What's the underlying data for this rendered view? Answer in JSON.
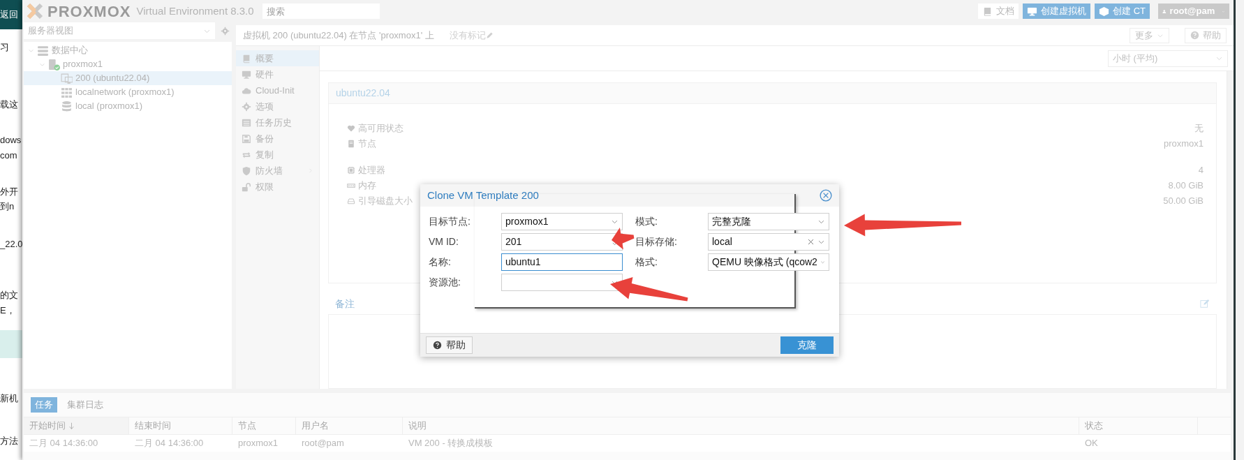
{
  "background_page": {
    "back_button": "返回",
    "fragments": [
      "习",
      "载这",
      "dows",
      "com",
      "外开",
      "到n",
      "_22.0",
      "的文",
      "E，",
      "新机",
      "方法"
    ]
  },
  "header": {
    "logo": "PROXMOX",
    "product": "Virtual Environment 8.3.0",
    "search_placeholder": "搜索",
    "buttons": [
      {
        "label": "文档",
        "kind": "docs"
      },
      {
        "label": "创建虚拟机",
        "kind": "vm"
      },
      {
        "label": "创建 CT",
        "kind": "ct"
      }
    ],
    "user": "root@pam"
  },
  "tree_panel": {
    "view": "服务器视图",
    "tree": [
      {
        "label": "数据中心",
        "kind": "datacenter",
        "expanded": true,
        "selected": false,
        "children": [
          {
            "label": "proxmox1",
            "kind": "node",
            "expanded": true,
            "selected": false,
            "children": [
              {
                "label": "200 (ubuntu22.04)",
                "kind": "template",
                "selected": true
              },
              {
                "label": "localnetwork (proxmox1)",
                "kind": "network",
                "selected": false
              },
              {
                "label": "local (proxmox1)",
                "kind": "storage",
                "selected": false
              }
            ]
          }
        ]
      }
    ]
  },
  "content": {
    "title": "虚拟机 200 (ubuntu22.04) 在节点 'proxmox1' 上",
    "tags": "没有标记",
    "buttons": [
      {
        "label": "更多",
        "kind": "menu"
      },
      {
        "label": "帮助",
        "kind": "help"
      }
    ],
    "menu": [
      {
        "label": "概要",
        "kind": "summary",
        "selected": true,
        "has_submenu": false
      },
      {
        "label": "硬件",
        "kind": "hardware",
        "selected": false,
        "has_submenu": false
      },
      {
        "label": "Cloud-Init",
        "kind": "cloudinit",
        "selected": false,
        "has_submenu": false
      },
      {
        "label": "选项",
        "kind": "options",
        "selected": false,
        "has_submenu": false
      },
      {
        "label": "任务历史",
        "kind": "history",
        "selected": false,
        "has_submenu": false
      },
      {
        "label": "备份",
        "kind": "backup",
        "selected": false,
        "has_submenu": false
      },
      {
        "label": "复制",
        "kind": "replication",
        "selected": false,
        "has_submenu": false
      },
      {
        "label": "防火墙",
        "kind": "firewall",
        "selected": false,
        "has_submenu": true
      },
      {
        "label": "权限",
        "kind": "permissions",
        "selected": false,
        "has_submenu": false
      }
    ],
    "timeframe": "小时 (平均)",
    "summary": {
      "title": "ubuntu22.04",
      "groups": [
        [
          {
            "label": "高可用状态",
            "kind": "ha",
            "value": "无"
          },
          {
            "label": "节点",
            "kind": "node",
            "value": "proxmox1"
          }
        ],
        [
          {
            "label": "处理器",
            "kind": "cpu",
            "value": "4"
          },
          {
            "label": "内存",
            "kind": "memory",
            "value": "8.00 GiB"
          },
          {
            "label": "引导磁盘大小",
            "kind": "disk",
            "value": "50.00 GiB"
          }
        ]
      ]
    },
    "notes": {
      "title": "备注"
    }
  },
  "tasks": {
    "tabs": [
      {
        "label": "任务",
        "selected": true
      },
      {
        "label": "集群日志",
        "selected": false
      }
    ],
    "columns": [
      {
        "label": "开始时间",
        "sorted": true
      },
      {
        "label": "结束时间",
        "sorted": false
      },
      {
        "label": "节点",
        "sorted": false
      },
      {
        "label": "用户名",
        "sorted": false
      },
      {
        "label": "说明",
        "sorted": false
      },
      {
        "label": "状态",
        "sorted": false
      }
    ],
    "rows": [
      [
        "二月 04 14:36:00",
        "二月 04 14:36:00",
        "proxmox1",
        "root@pam",
        "VM 200 - 转换成模板",
        "OK"
      ]
    ]
  },
  "dialog": {
    "title": "Clone VM Template 200",
    "left_fields": [
      {
        "label": "目标节点:",
        "kind": "combo",
        "value": "proxmox1",
        "focused": false
      },
      {
        "label": "VM ID:",
        "kind": "spinner",
        "value": "201",
        "focused": false
      },
      {
        "label": "名称:",
        "kind": "text",
        "value": "ubuntu1",
        "focused": true
      },
      {
        "label": "资源池:",
        "kind": "combo",
        "focused": false
      }
    ],
    "right_fields": [
      {
        "label": "模式:",
        "kind": "combo",
        "value": "完整克隆",
        "focused": false
      },
      {
        "label": "目标存储:",
        "kind": "combo",
        "value": "local",
        "clearable": true,
        "focused": false
      },
      {
        "label": "格式:",
        "kind": "combo",
        "value": "QEMU 映像格式 (qcow2",
        "focused": false
      }
    ],
    "help_button": "帮助",
    "clone_button": "克隆"
  }
}
